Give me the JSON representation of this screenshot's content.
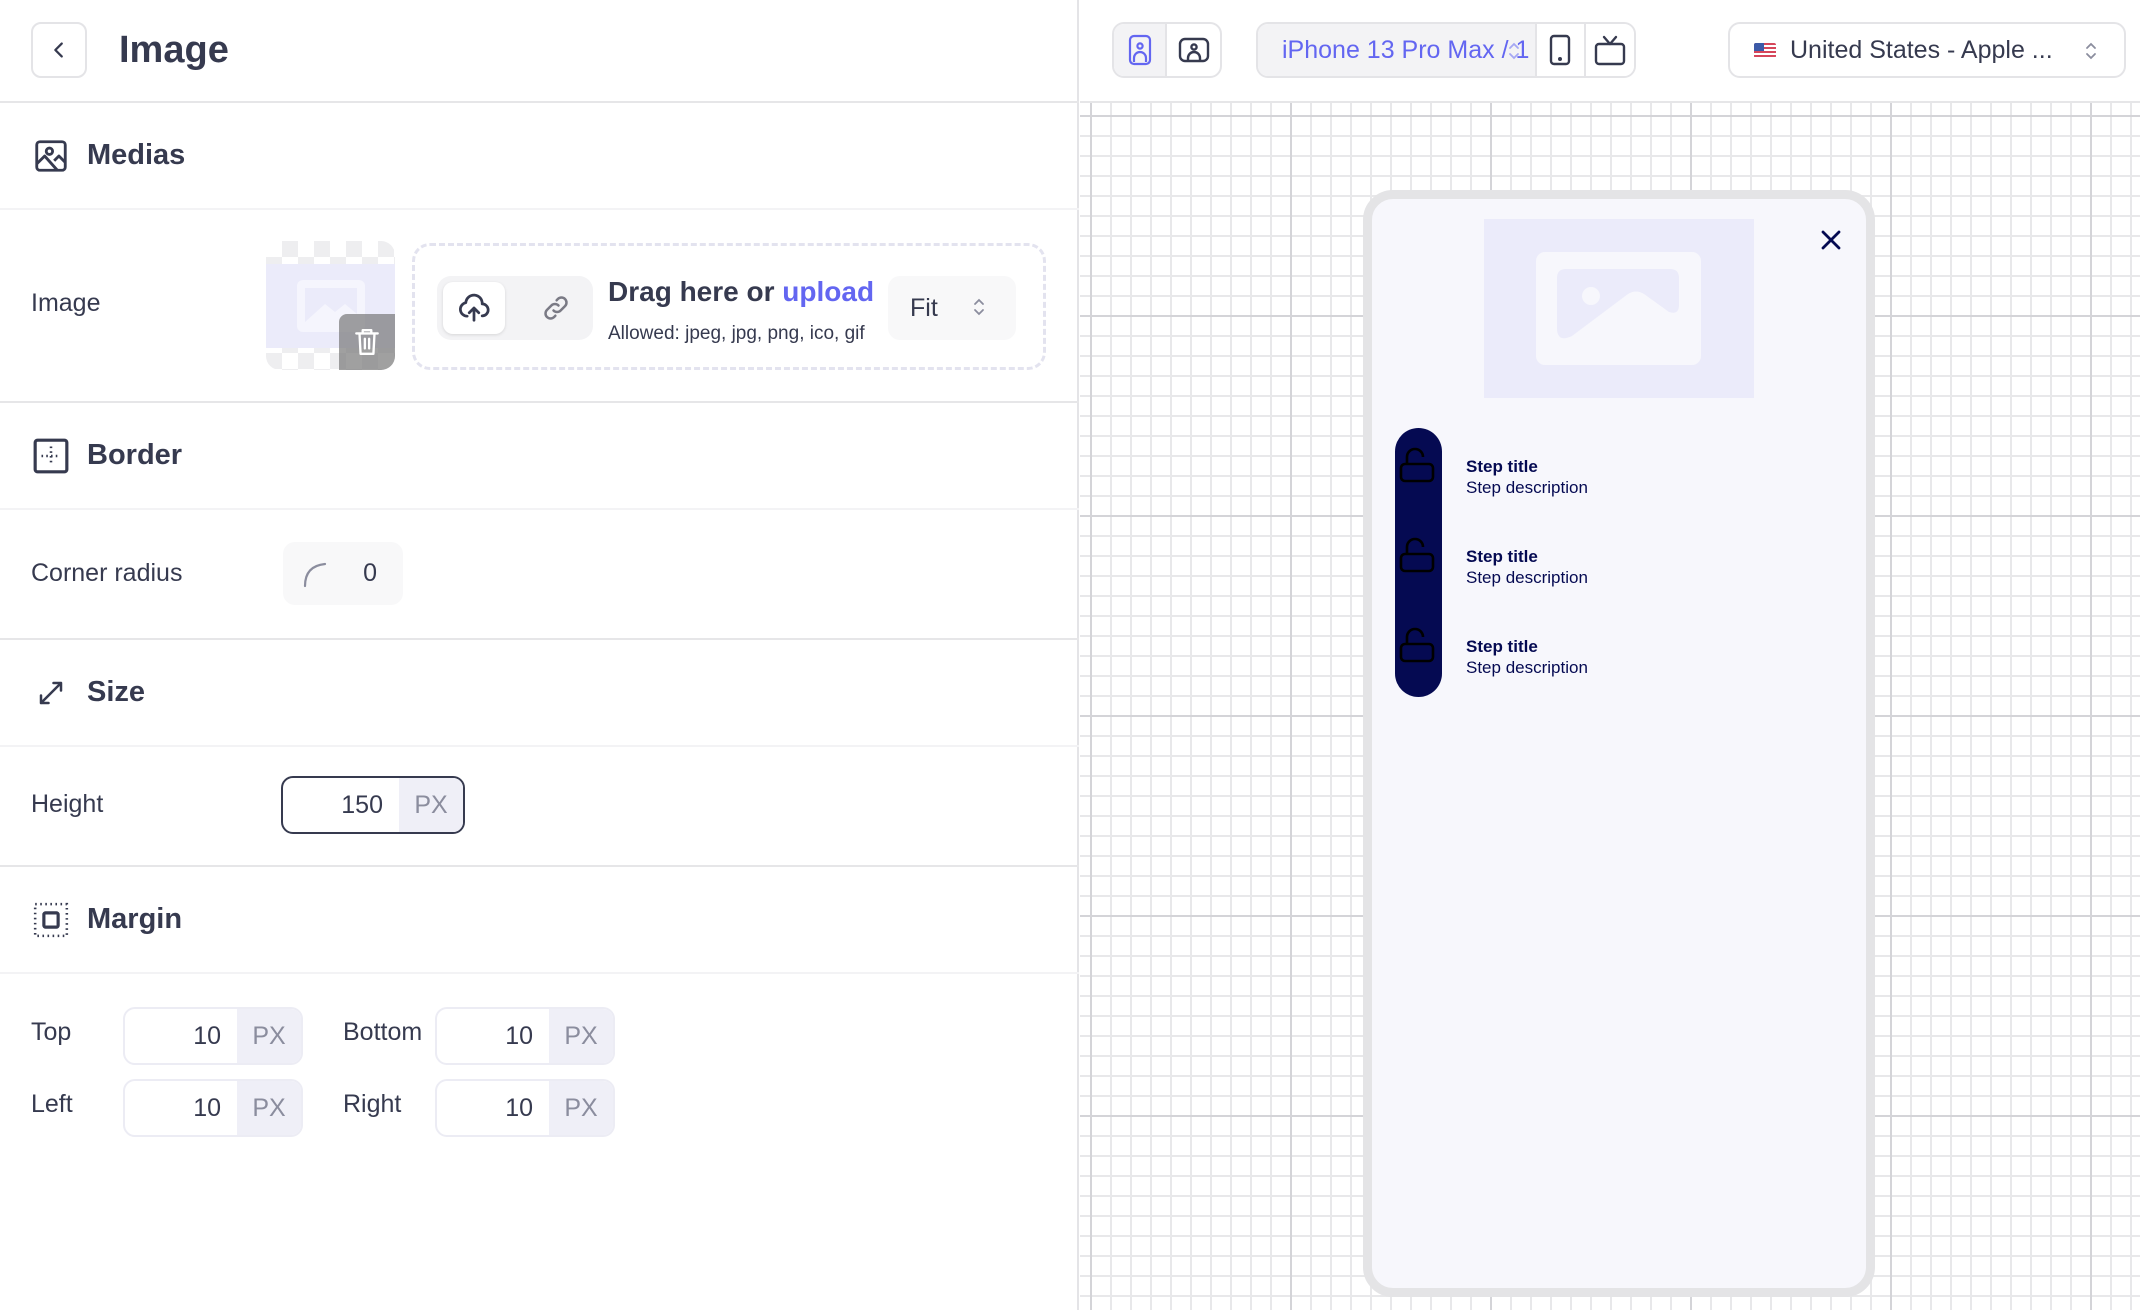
{
  "header": {
    "title": "Image",
    "back_label": "Back"
  },
  "sections": {
    "medias": {
      "title": "Medias",
      "image_label": "Image",
      "dropzone": {
        "drag_text": "Drag here or ",
        "upload_link": "upload",
        "allowed": "Allowed: jpeg, jpg, png, ico, gif",
        "fit_value": "Fit"
      }
    },
    "border": {
      "title": "Border",
      "corner_radius_label": "Corner radius",
      "corner_radius_value": "0"
    },
    "size": {
      "title": "Size",
      "height_label": "Height",
      "height_value": "150",
      "height_unit": "PX"
    },
    "margin": {
      "title": "Margin",
      "fields": [
        {
          "label": "Top",
          "value": "10",
          "unit": "PX"
        },
        {
          "label": "Bottom",
          "value": "10",
          "unit": "PX"
        },
        {
          "label": "Left",
          "value": "10",
          "unit": "PX"
        },
        {
          "label": "Right",
          "value": "10",
          "unit": "PX"
        }
      ]
    }
  },
  "preview_toolbar": {
    "device": "iPhone 13 Pro Max / 1",
    "locale_flag": "us-flag",
    "locale": "United States - Apple ..."
  },
  "preview": {
    "steps": [
      {
        "title": "Step title",
        "description": "Step description"
      },
      {
        "title": "Step title",
        "description": "Step description"
      },
      {
        "title": "Step title",
        "description": "Step description"
      }
    ]
  },
  "colors": {
    "accent": "#6366f1",
    "text": "#363a4f",
    "stepper_navy": "#050a52",
    "placeholder": "#ebebfa"
  }
}
